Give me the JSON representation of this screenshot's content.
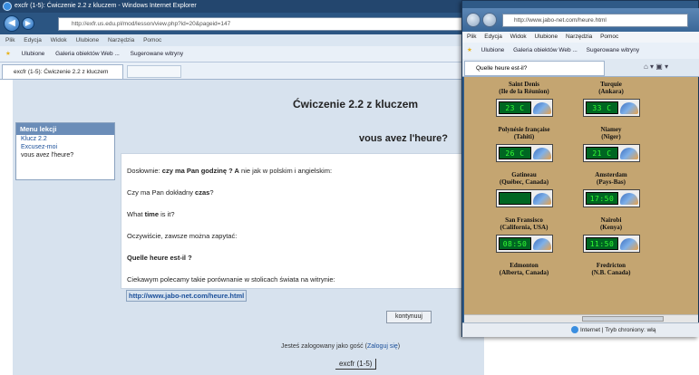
{
  "main_window": {
    "title": "excfr (1-5): Ćwiczenie 2.2 z kluczem - Windows Internet Explorer",
    "url": "http://exfr.us.edu.pl/mod/lesson/view.php?id=20&pageid=147",
    "menu": [
      "Plik",
      "Edycja",
      "Widok",
      "Ulubione",
      "Narzędzia",
      "Pomoc"
    ],
    "favorites": [
      "Ulubione",
      "Galeria obiektów Web ...",
      "Sugerowane witryny"
    ],
    "tab_title": "excfr (1-5): Ćwiczenie 2.2 z kluczem"
  },
  "page": {
    "heading": "Ćwiczenie 2.2 z kluczem",
    "subheading": "vous avez l'heure?",
    "sidebar": {
      "title": "Menu lekcji",
      "items": [
        "Klucz 2.2",
        "Excusez-moi",
        "vous avez l'heure?"
      ]
    },
    "lines": {
      "l1_prefix": "Dosłownie: ",
      "l1_bold": "czy ma Pan godzinę ? A",
      "l1_rest": " nie jak w polskim i angielskim:",
      "l2_prefix": "Czy ma Pan dokładny ",
      "l2_bold": "czas",
      "l2_rest": "?",
      "l3_prefix": "What ",
      "l3_bold": "time",
      "l3_rest": " is it?",
      "l4": "Oczywiście, zawsze można zapytać:",
      "l5_bold": "Quelle heure est-il ?",
      "l6": "Ciekawym polecamy takie porównanie w stolicach świata na witrynie:",
      "link": "http://www.jabo-net.com/heure.html"
    },
    "continue_button": "kontynuuj",
    "login_text": "Jesteś zalogowany jako gość (",
    "login_link": "Zaloguj się",
    "login_close": ")",
    "footer_link": "excfr (1-5)"
  },
  "second_window": {
    "url": "http://www.jabo-net.com/heure.html",
    "menu": [
      "Plik",
      "Edycja",
      "Widok",
      "Ulubione",
      "Narzędzia",
      "Pomoc"
    ],
    "favorites": [
      "Ulubione",
      "Galeria obiektów Web ...",
      "Sugerowane witryny"
    ],
    "tab_title": "Quelle heure est-il?",
    "status": "Internet | Tryb chroniony: włą",
    "clocks": [
      {
        "name": "Saint Denis",
        "region": "(Ile de la Réunion)",
        "time": null
      },
      {
        "name": "Turquie",
        "region": "(Ankara)",
        "time": null
      },
      {
        "name": "",
        "region": "",
        "time": "23 C"
      },
      {
        "name": "",
        "region": "",
        "time": "33 C"
      },
      {
        "name": "Polynésie française",
        "region": "(Tahiti)",
        "time": null
      },
      {
        "name": "Niamey",
        "region": "(Niger)",
        "time": null
      },
      {
        "name": "",
        "region": "",
        "time": "26 C"
      },
      {
        "name": "",
        "region": "",
        "time": "21 C"
      },
      {
        "name": "Gatineau",
        "region": "(Québec, Canada)",
        "time": null
      },
      {
        "name": "Amsterdam",
        "region": "(Pays-Bas)",
        "time": null
      },
      {
        "name": "",
        "region": "",
        "time": ""
      },
      {
        "name": "",
        "region": "",
        "time": "17:50"
      },
      {
        "name": "San Fransisco",
        "region": "(California, USA)",
        "time": null
      },
      {
        "name": "Nairobi",
        "region": "(Kenya)",
        "time": null
      },
      {
        "name": "",
        "region": "",
        "time": "08:50"
      },
      {
        "name": "",
        "region": "",
        "time": "11:50"
      },
      {
        "name": "Edmonton",
        "region": "(Alberta, Canada)",
        "time": null
      },
      {
        "name": "Fredricton",
        "region": "(N.B. Canada)",
        "time": null
      }
    ]
  }
}
